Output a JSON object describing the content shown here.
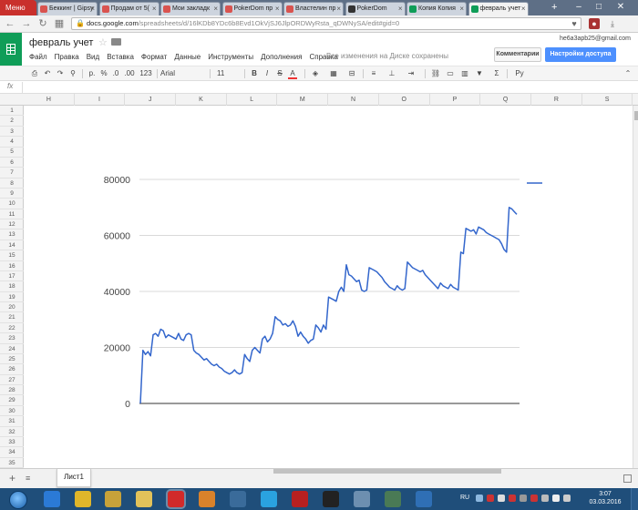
{
  "browser": {
    "menu_label": "Меню",
    "tabs": [
      {
        "label": "Беккинг | Gipsy",
        "icon_color": "#d9534f",
        "active": false
      },
      {
        "label": "Продам от 5(",
        "icon_color": "#d9534f",
        "active": false
      },
      {
        "label": "Мои закладк",
        "icon_color": "#d9534f",
        "active": false
      },
      {
        "label": "PokerDom пр",
        "icon_color": "#d9534f",
        "active": false
      },
      {
        "label": "Властелин пр",
        "icon_color": "#d9534f",
        "active": false
      },
      {
        "label": "PokerDom",
        "icon_color": "#333333",
        "active": false
      },
      {
        "label": "Копия Копия",
        "icon_color": "#0f9d58",
        "active": false
      },
      {
        "label": "февраль учет",
        "icon_color": "#0f9d58",
        "active": true
      }
    ],
    "new_tab": "+",
    "url_host": "docs.google.com",
    "url_path": "/spreadsheets/d/16lKDb8YDc6b8Evd1OkVjSJ6JlpORDWyRsta_qDWNySA/edit#gid=0"
  },
  "doc": {
    "title": "февраль учет",
    "menus": [
      "Файл",
      "Правка",
      "Вид",
      "Вставка",
      "Формат",
      "Данные",
      "Инструменты",
      "Дополнения",
      "Справка"
    ],
    "save_status": "Все изменения на Диске сохранены",
    "user_email": "he6a3apb25@gmail.com",
    "comments_label": "Комментарии",
    "share_label": "Настройки доступа"
  },
  "toolbar": {
    "currency": "р.",
    "percent": "%",
    "dec_less": ".0",
    "dec_more": ".00",
    "format_more": "123",
    "font": "Arial",
    "font_size": "11",
    "bold": "B",
    "italic": "I",
    "strike": "S",
    "text_color": "A",
    "functions": "Σ",
    "input_tools": "Ру"
  },
  "formula_bar": {
    "fx": "fx"
  },
  "grid": {
    "columns": [
      "H",
      "I",
      "J",
      "K",
      "L",
      "M",
      "N",
      "O",
      "P",
      "Q",
      "R",
      "S"
    ],
    "rows": [
      "1",
      "2",
      "3",
      "4",
      "5",
      "6",
      "7",
      "8",
      "9",
      "10",
      "11",
      "12",
      "13",
      "14",
      "15",
      "16",
      "17",
      "18",
      "19",
      "20",
      "21",
      "22",
      "23",
      "24",
      "25",
      "26",
      "27",
      "28",
      "29",
      "30",
      "31",
      "32",
      "33",
      "34",
      "35"
    ]
  },
  "sheets": {
    "add": "+",
    "all": "≡",
    "tab_label": "Лист1"
  },
  "taskbar": {
    "lang": "RU",
    "time": "3:07",
    "date": "03.03.2016"
  },
  "chart_data": {
    "type": "line",
    "title": "",
    "xlabel": "",
    "ylabel": "",
    "ylim": [
      0,
      80000
    ],
    "yticks": [
      "0",
      "20000",
      "40000",
      "60000",
      "80000"
    ],
    "grid": true,
    "legend": "right",
    "color": "#3366cc",
    "series": [
      {
        "values": [
          0,
          19000,
          17500,
          18500,
          17000,
          24500,
          25000,
          24000,
          26500,
          26000,
          23500,
          24500,
          24000,
          23500,
          23000,
          25000,
          23000,
          22500,
          24500,
          25000,
          24500,
          19000,
          18000,
          17500,
          16500,
          15500,
          16000,
          15000,
          14000,
          13500,
          14000,
          13000,
          12500,
          11500,
          11000,
          10500,
          11000,
          12000,
          11000,
          10500,
          11000,
          17500,
          16000,
          15000,
          19000,
          20000,
          19000,
          18000,
          23000,
          24000,
          22000,
          23000,
          25000,
          31000,
          30000,
          29500,
          28000,
          28500,
          27500,
          28000,
          29500,
          27500,
          24000,
          25500,
          24000,
          23000,
          21500,
          22500,
          23000,
          28000,
          27000,
          25500,
          28000,
          26500,
          38000,
          37500,
          37000,
          36500,
          40000,
          41500,
          40000,
          49500,
          46000,
          45500,
          44500,
          43500,
          44000,
          40500,
          40000,
          40500,
          48500,
          48000,
          47500,
          47000,
          46000,
          45000,
          43500,
          42500,
          41500,
          41000,
          40500,
          42000,
          41000,
          40500,
          41000,
          50500,
          49500,
          48500,
          48000,
          47500,
          47000,
          47500,
          46000,
          45000,
          44000,
          43000,
          42000,
          41000,
          43000,
          42000,
          41500,
          41000,
          42500,
          41500,
          41000,
          40500,
          54000,
          53500,
          62500,
          62000,
          61500,
          62000,
          60500,
          63000,
          62500,
          62000,
          61000,
          60500,
          60000,
          59500,
          59000,
          58500,
          57000,
          55000,
          54000,
          70000,
          69500,
          68500,
          67500
        ]
      }
    ]
  }
}
